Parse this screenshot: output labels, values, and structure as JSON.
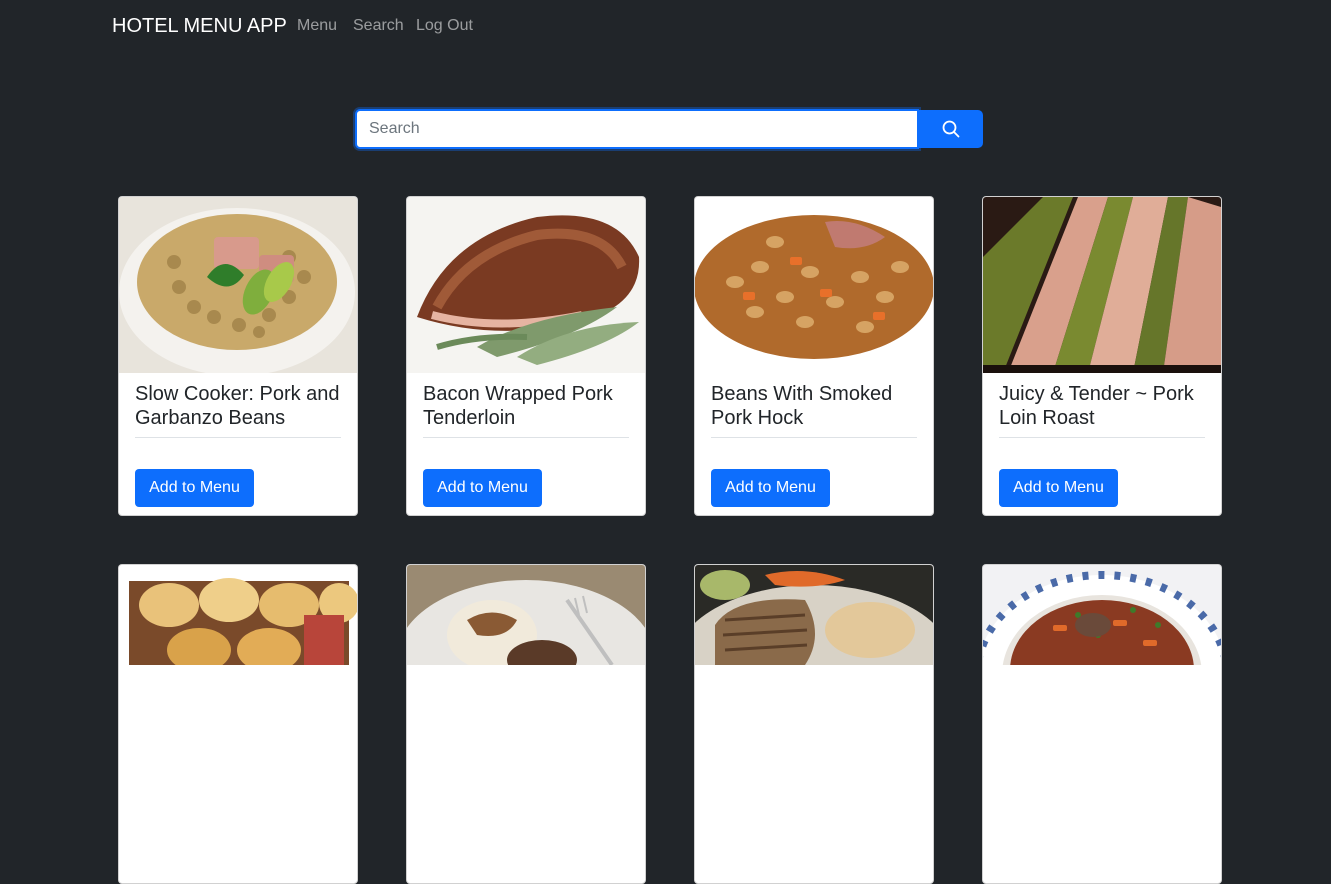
{
  "nav": {
    "brand": "HOTEL MENU APP",
    "links": [
      "Menu",
      "Search",
      "Log Out"
    ]
  },
  "search": {
    "placeholder": "Search",
    "value": "",
    "button_icon": "search-icon"
  },
  "colors": {
    "background": "#212529",
    "primary": "#0d6efd",
    "card": "#ffffff"
  },
  "recipes": [
    {
      "title": "Slow Cooker: Pork and Garbanzo Beans",
      "button": "Add to Menu",
      "image": "pork-garbanzo-bean-stew-photo"
    },
    {
      "title": "Bacon Wrapped Pork Tenderloin",
      "button": "Add to Menu",
      "image": "bacon-wrapped-tenderloin-photo"
    },
    {
      "title": "Beans With Smoked Pork Hock",
      "button": "Add to Menu",
      "image": "beans-pork-hock-photo"
    },
    {
      "title": "Juicy & Tender ~ Pork Loin Roast",
      "button": "Add to Menu",
      "image": "pork-loin-roast-photo"
    }
  ],
  "recipes_row2_images": [
    "bread-rolls-photo",
    "mashed-potatoes-gravy-photo",
    "grilled-pork-chop-photo",
    "stew-in-bowl-photo"
  ]
}
